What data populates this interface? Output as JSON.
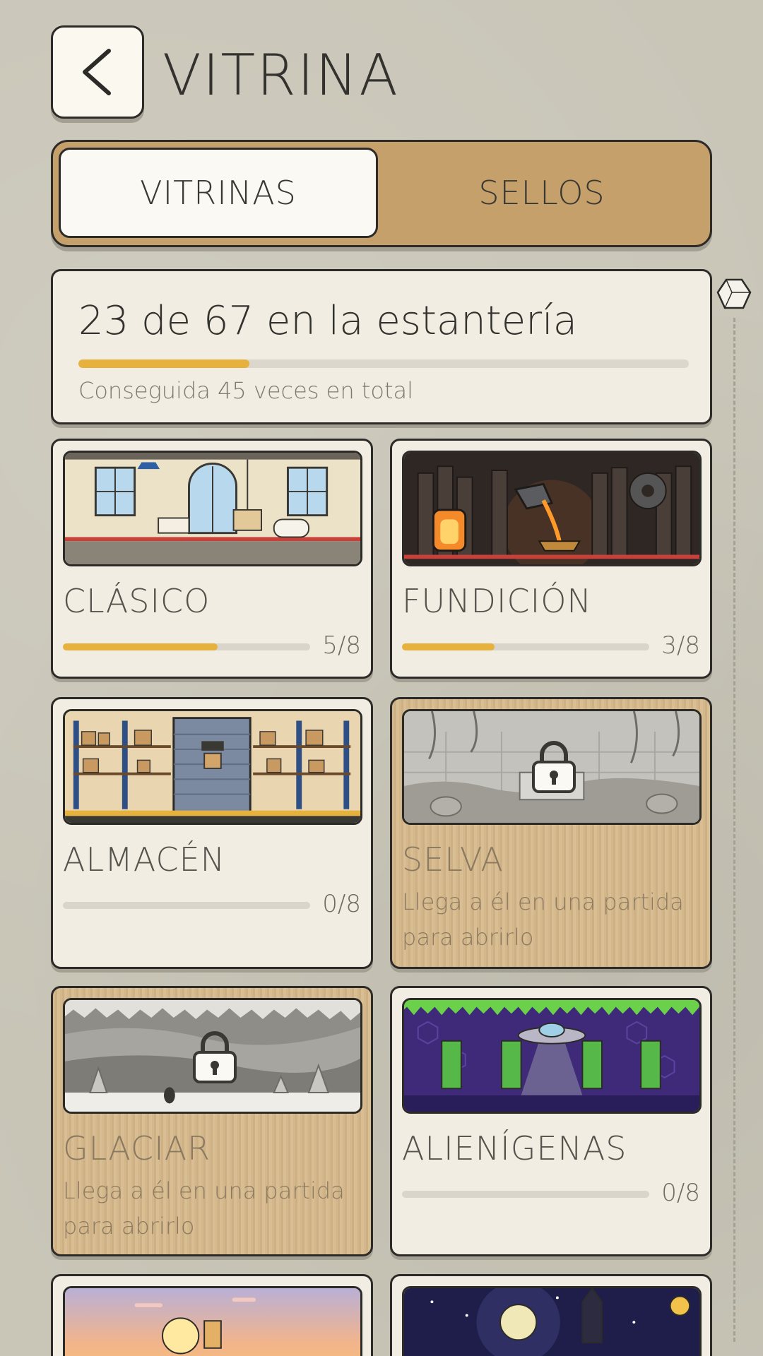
{
  "header": {
    "title": "VITRINA",
    "back_icon": "chevron-left-icon"
  },
  "tabs": [
    {
      "label": "VITRINAS",
      "active": true
    },
    {
      "label": "SELLOS",
      "active": false
    }
  ],
  "summary": {
    "title": "23 de 67 en la estantería",
    "progress": 0.28,
    "subtitle": "Conseguida 45 veces en total"
  },
  "cards": [
    {
      "name": "CLÁSICO",
      "count": "5/8",
      "progress": 0.625,
      "locked": false
    },
    {
      "name": "FUNDICIÓN",
      "count": "3/8",
      "progress": 0.375,
      "locked": false
    },
    {
      "name": "ALMACÉN",
      "count": "0/8",
      "progress": 0,
      "locked": false
    },
    {
      "name": "SELVA",
      "locked": true,
      "locked_text": "Llega a él en una partida para abrirlo"
    },
    {
      "name": "GLACIAR",
      "locked": true,
      "locked_text": "Llega a él en una partida para abrirlo"
    },
    {
      "name": "ALIENÍGENAS",
      "count": "0/8",
      "progress": 0,
      "locked": false
    }
  ],
  "colors": {
    "accent": "#e7b13e",
    "tab_bg": "#c6a06a",
    "background": "#c9c6b8"
  }
}
